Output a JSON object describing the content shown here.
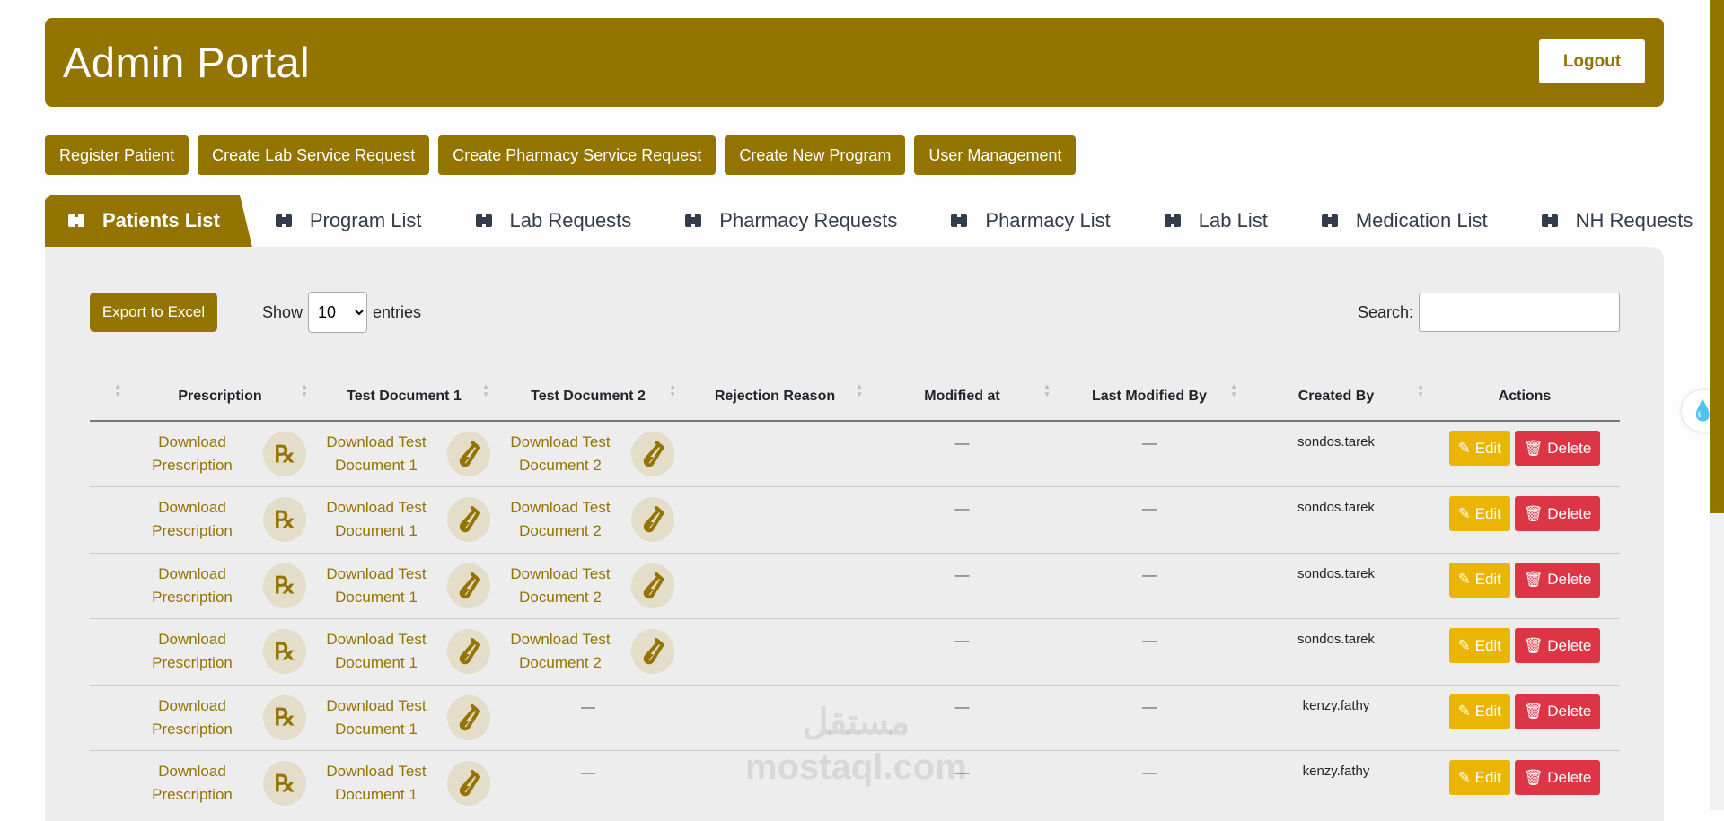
{
  "header": {
    "title": "Admin Portal",
    "logout": "Logout"
  },
  "actions": [
    "Register Patient",
    "Create Lab Service Request",
    "Create Pharmacy Service Request",
    "Create New Program",
    "User Management"
  ],
  "tabs": [
    "Patients List",
    "Program List",
    "Lab Requests",
    "Pharmacy Requests",
    "Pharmacy List",
    "Lab List",
    "Medication List",
    "NH Requests"
  ],
  "controls": {
    "export": "Export to Excel",
    "show": "Show",
    "entries_value": "10",
    "entries": "entries",
    "search": "Search:"
  },
  "columns": [
    "",
    "Prescription",
    "Test Document 1",
    "Test Document 2",
    "Rejection Reason",
    "Modified at",
    "Last Modified By",
    "Created By",
    "Actions"
  ],
  "labels": {
    "download_prescription": "Download Prescription",
    "download_td1": "Download Test Document 1",
    "download_td2": "Download Test Document 2",
    "edit": "Edit",
    "delete": "Delete",
    "dash": "—",
    "rx": "℞"
  },
  "rows": [
    {
      "td2": true,
      "created_by": "sondos.tarek"
    },
    {
      "td2": true,
      "created_by": "sondos.tarek"
    },
    {
      "td2": true,
      "created_by": "sondos.tarek"
    },
    {
      "td2": true,
      "created_by": "sondos.tarek"
    },
    {
      "td2": false,
      "created_by": "kenzy.fathy"
    },
    {
      "td2": false,
      "created_by": "kenzy.fathy"
    }
  ],
  "watermark": {
    "arabic": "مستقل",
    "latin": "mostaql.com"
  },
  "colors": {
    "brand": "#947400",
    "edit": "#ebb505",
    "delete": "#dc3545"
  }
}
